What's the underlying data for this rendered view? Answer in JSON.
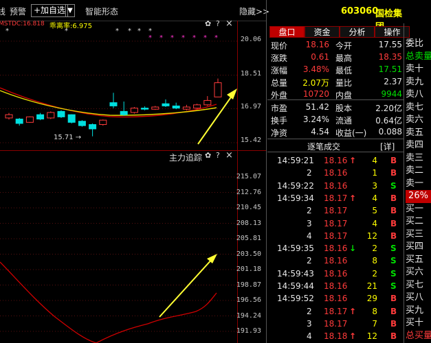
{
  "toolbar": {
    "cut_label": "线",
    "alert_label": "预警",
    "add_fav_label": "+加自选",
    "dropdown_label": "▼",
    "smart_label": "智能形态",
    "hide_label": "隐藏>>"
  },
  "price_chart": {
    "indicator_prefix": "MSTDC:16.818",
    "indicator_name": "乖离率:6.975",
    "y_ticks": [
      "20.06",
      "18.51",
      "16.97",
      "15.42"
    ],
    "low_label": "15.71",
    "candles": [
      {
        "o": 16.55,
        "c": 16.7,
        "h": 16.78,
        "l": 16.48
      },
      {
        "o": 16.5,
        "c": 16.3,
        "h": 16.55,
        "l": 16.2
      },
      {
        "o": 16.35,
        "c": 16.6,
        "h": 16.62,
        "l": 16.33
      },
      {
        "o": 16.7,
        "c": 16.5,
        "h": 16.78,
        "l": 16.45
      },
      {
        "o": 16.55,
        "c": 16.8,
        "h": 16.85,
        "l": 16.5
      },
      {
        "o": 16.85,
        "c": 16.6,
        "h": 16.9,
        "l": 16.55
      },
      {
        "o": 16.7,
        "c": 16.35,
        "h": 16.72,
        "l": 16.3
      },
      {
        "o": 16.4,
        "c": 16.2,
        "h": 16.45,
        "l": 16.15
      },
      {
        "o": 16.25,
        "c": 16.05,
        "h": 16.3,
        "l": 15.71
      },
      {
        "o": 16.25,
        "c": 16.45,
        "h": 16.48,
        "l": 16.2
      },
      {
        "o": 17.25,
        "c": 17.1,
        "h": 17.7,
        "l": 17.0
      },
      {
        "o": 16.85,
        "c": 16.7,
        "h": 17.3,
        "l": 16.65
      },
      {
        "o": 16.8,
        "c": 17.0,
        "h": 17.05,
        "l": 16.75
      },
      {
        "o": 17.0,
        "c": 16.95,
        "h": 17.08,
        "l": 16.9
      },
      {
        "o": 16.95,
        "c": 17.05,
        "h": 17.1,
        "l": 16.92
      },
      {
        "o": 17.2,
        "c": 17.1,
        "h": 17.4,
        "l": 17.05
      },
      {
        "o": 17.1,
        "c": 17.0,
        "h": 17.25,
        "l": 16.95
      },
      {
        "o": 16.95,
        "c": 17.05,
        "h": 17.15,
        "l": 16.9
      },
      {
        "o": 17.0,
        "c": 17.15,
        "h": 17.2,
        "l": 16.95
      },
      {
        "o": 17.15,
        "c": 17.35,
        "h": 17.55,
        "l": 17.1
      },
      {
        "o": 17.51,
        "c": 18.16,
        "h": 18.35,
        "l": 17.51
      }
    ]
  },
  "indicator_chart": {
    "title": "主力追踪",
    "y_ticks": [
      "215.07",
      "212.76",
      "210.45",
      "208.13",
      "205.81",
      "203.50",
      "201.18",
      "198.87",
      "196.56",
      "194.24",
      "191.93"
    ]
  },
  "pane_controls": {
    "gear": "✿",
    "help": "?",
    "close": "×"
  },
  "stock": {
    "code": "603060",
    "name": "国检集团"
  },
  "tabs": [
    "盘口",
    "资金",
    "分析",
    "操作"
  ],
  "quote_rows": [
    {
      "l1": "现价",
      "v1": "18.16",
      "c1": "red",
      "l2": "今开",
      "v2": "17.55",
      "c2": "white"
    },
    {
      "l1": "涨跌",
      "v1": "0.61",
      "c1": "red",
      "l2": "最高",
      "v2": "18.35",
      "c2": "red"
    },
    {
      "l1": "涨幅",
      "v1": "3.48%",
      "c1": "red",
      "l2": "最低",
      "v2": "17.51",
      "c2": "green"
    },
    {
      "l1": "总量",
      "v1": "2.07万",
      "c1": "yellow",
      "l2": "量比",
      "v2": "2.37",
      "c2": "white"
    },
    {
      "l1": "外盘",
      "v1": "10720",
      "c1": "red",
      "l2": "内盘",
      "v2": "9944",
      "c2": "green"
    }
  ],
  "quote_rows2": [
    {
      "l1": "市盈",
      "v1": "51.42",
      "l2": "股本",
      "v2": "2.20亿"
    },
    {
      "l1": "换手",
      "v1": "3.24%",
      "l2": "流通",
      "v2": "0.64亿"
    },
    {
      "l1": "净资",
      "v1": "4.54",
      "l2": "收益(一)",
      "v2": "0.088"
    }
  ],
  "trades_header": {
    "title": "逐笔成交",
    "detail": "[详]"
  },
  "trades": [
    {
      "t": "14:59:21",
      "p": "18.16",
      "arrow": "↑",
      "ac": "red",
      "v": "4",
      "s": "B"
    },
    {
      "t": "2",
      "p": "18.16",
      "arrow": "",
      "ac": "",
      "v": "1",
      "s": "B"
    },
    {
      "t": "14:59:22",
      "p": "18.16",
      "arrow": "",
      "ac": "",
      "v": "3",
      "s": "S"
    },
    {
      "t": "14:59:34",
      "p": "18.17",
      "arrow": "↑",
      "ac": "red",
      "v": "4",
      "s": "B"
    },
    {
      "t": "2",
      "p": "18.17",
      "arrow": "",
      "ac": "",
      "v": "5",
      "s": "B"
    },
    {
      "t": "3",
      "p": "18.17",
      "arrow": "",
      "ac": "",
      "v": "4",
      "s": "B"
    },
    {
      "t": "4",
      "p": "18.17",
      "arrow": "",
      "ac": "",
      "v": "12",
      "s": "B"
    },
    {
      "t": "14:59:35",
      "p": "18.16",
      "arrow": "↓",
      "ac": "green",
      "v": "2",
      "s": "S"
    },
    {
      "t": "2",
      "p": "18.16",
      "arrow": "",
      "ac": "",
      "v": "8",
      "s": "S"
    },
    {
      "t": "14:59:43",
      "p": "18.16",
      "arrow": "",
      "ac": "",
      "v": "2",
      "s": "S"
    },
    {
      "t": "14:59:44",
      "p": "18.16",
      "arrow": "",
      "ac": "",
      "v": "21",
      "s": "S"
    },
    {
      "t": "14:59:52",
      "p": "18.16",
      "arrow": "",
      "ac": "",
      "v": "29",
      "s": "B"
    },
    {
      "t": "2",
      "p": "18.17",
      "arrow": "↑",
      "ac": "red",
      "v": "8",
      "s": "B"
    },
    {
      "t": "3",
      "p": "18.17",
      "arrow": "",
      "ac": "",
      "v": "7",
      "s": "B"
    },
    {
      "t": "4",
      "p": "18.18",
      "arrow": "↑",
      "ac": "red",
      "v": "12",
      "s": "B"
    }
  ],
  "side_column": {
    "top": "委比",
    "sell_total": "总卖量",
    "sells": [
      "卖十",
      "卖九",
      "卖八",
      "卖七",
      "卖六",
      "卖五",
      "卖四",
      "卖三",
      "卖二",
      "卖一"
    ],
    "pct": "26%",
    "buys": [
      "买一",
      "买二",
      "买三",
      "买四",
      "买五",
      "买六",
      "买七",
      "买八",
      "买九",
      "买十"
    ],
    "buy_total": "总买量"
  },
  "colors": {
    "up": "#ff3b3b",
    "down": "#00e0e0",
    "ma_red": "#d00000",
    "ma_yellow": "#e8d800",
    "arrow": "#ffff33",
    "accent": "#c00000"
  }
}
